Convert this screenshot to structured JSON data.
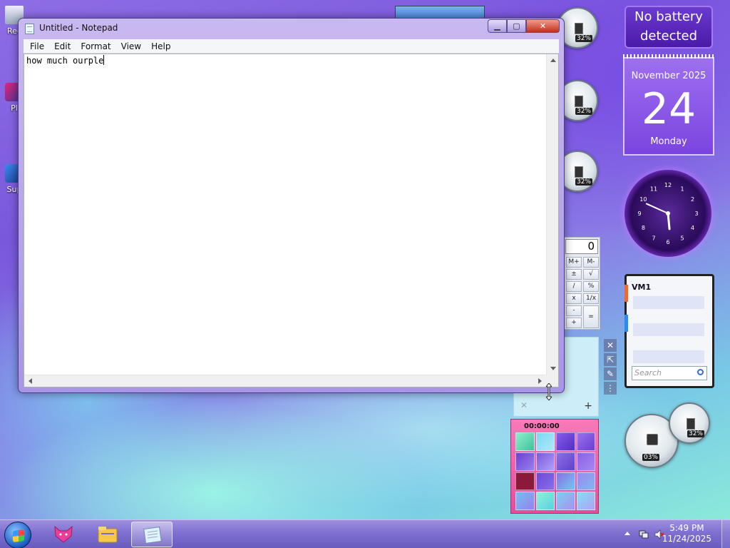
{
  "desktop": {
    "icons": [
      {
        "label": "Rec",
        "icon": "recycle-bin-icon"
      },
      {
        "label": "Pl",
        "icon": "player-icon"
      },
      {
        "label": "Sup",
        "icon": "support-icon"
      }
    ]
  },
  "notepad": {
    "title": "Untitled - Notepad",
    "menu": [
      "File",
      "Edit",
      "Format",
      "View",
      "Help"
    ],
    "content": "how much ourple"
  },
  "gadgets": {
    "cpu_gauges": [
      {
        "percent": "32%"
      },
      {
        "percent": "32%"
      },
      {
        "percent": "32%"
      }
    ],
    "battery": {
      "line1": "No battery",
      "line2": "detected"
    },
    "calendar": {
      "month_year": "November 2025",
      "day": "24",
      "weekday": "Monday"
    },
    "clock": {
      "hour": 5,
      "minute": 49
    },
    "calculator": {
      "display": "0",
      "keys": [
        "M+",
        "M-",
        "±",
        "√",
        "/",
        "%",
        "x",
        "1/x",
        "-",
        "=",
        "+"
      ]
    },
    "feed": {
      "title": "VM1",
      "search_placeholder": "Search"
    },
    "puzzle": {
      "timer": "00:00:00"
    },
    "meter_large": {
      "percent": "03%"
    },
    "meter_small": {
      "percent": "32%"
    }
  },
  "taskbar": {
    "time": "5:49 PM",
    "date": "11/24/2025",
    "pinned": [
      "wolf-app-icon",
      "explorer-icon",
      "notepad-icon"
    ]
  }
}
